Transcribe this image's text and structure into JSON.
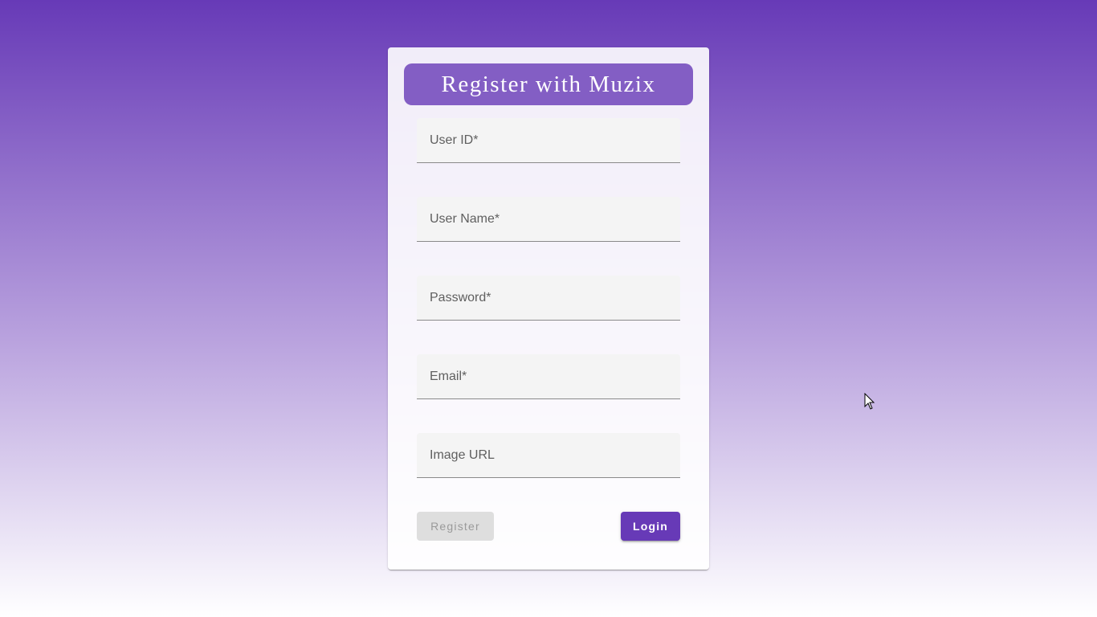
{
  "title": "Register with Muzix",
  "fields": [
    {
      "label": "User ID*",
      "value": ""
    },
    {
      "label": "User Name*",
      "value": ""
    },
    {
      "label": "Password*",
      "value": ""
    },
    {
      "label": "Email*",
      "value": ""
    },
    {
      "label": "Image URL",
      "value": ""
    }
  ],
  "buttons": {
    "register": "Register",
    "login": "Login",
    "register_disabled": true
  },
  "colors": {
    "accent": "#673ab7",
    "title_bg": "#835ec4"
  }
}
